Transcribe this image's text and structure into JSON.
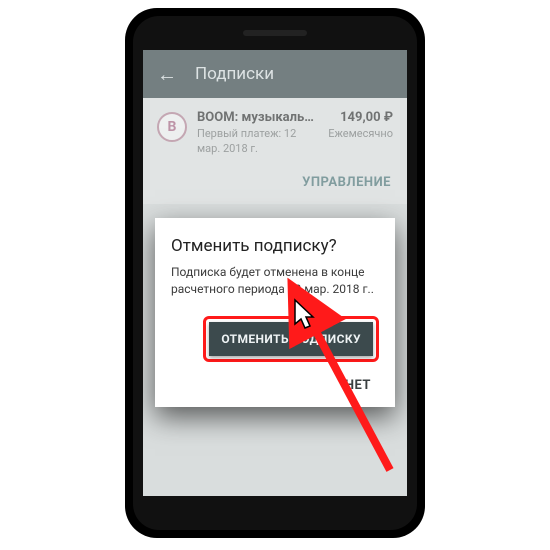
{
  "appbar": {
    "title": "Подписки"
  },
  "subscription": {
    "icon_letter": "B",
    "title": "BOOM: музыкальный…",
    "meta": "Первый платеж: 12 мар. 2018 г.",
    "price": "149,00 ₽",
    "cycle": "Ежемесячно",
    "manage_label": "УПРАВЛЕНИЕ"
  },
  "dialog": {
    "title": "Отменить подписку?",
    "body": "Подписка будет отменена в конце расчетного периода 12 мар. 2018 г..",
    "confirm_label": "ОТМЕНИТЬ ПОДПИСКУ",
    "deny_label": "НЕТ"
  }
}
